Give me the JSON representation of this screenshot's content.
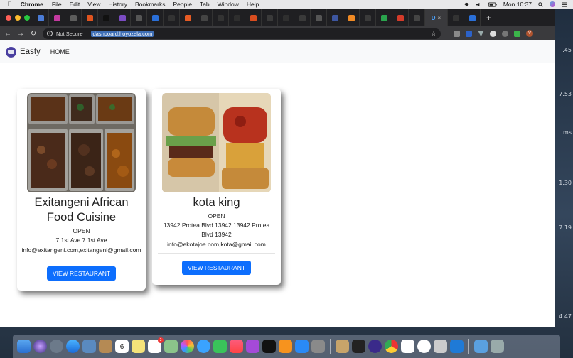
{
  "menubar": {
    "app_name": "Chrome",
    "items": [
      "File",
      "Edit",
      "View",
      "History",
      "Bookmarks",
      "People",
      "Tab",
      "Window",
      "Help"
    ],
    "clock": "Mon 10:37"
  },
  "browser": {
    "security_label": "Not Secure",
    "url": "dashboard.hoyozela.com",
    "active_tab_label": "D",
    "tab_favicon_colors": [
      "#4a7bd6",
      "#c43aa0",
      "#5c5c5c",
      "#e0541f",
      "#111",
      "#7a4bc2",
      "#555",
      "#2a6fd8",
      "#333",
      "#e65b24",
      "#444",
      "#333",
      "#2e2e2e",
      "#d94d1f",
      "#3a3a3a",
      "#2f2f2f",
      "#3a3a3a",
      "#555",
      "#3d56a0",
      "#f08a24",
      "#3a3a3a",
      "#2aa44d",
      "#d43b2a",
      "#444",
      "#333",
      "#2a6fd8"
    ],
    "avatar_letter": "V"
  },
  "navbar": {
    "brand": "Easty",
    "home_link": "HOME"
  },
  "restaurants": [
    {
      "name": "Exitangeni African Food Cuisine",
      "status": "OPEN",
      "address": "7 1st Ave 7 1st Ave",
      "email": "info@exitangeni.com,exitangeni@gmail.com",
      "button": "VIEW RESTAURANT"
    },
    {
      "name": "kota king",
      "status": "OPEN",
      "address": "13942 Protea Blvd 13942 13942 Protea Blvd 13942",
      "email": "info@ekotajoe.com,kota@gmail.com",
      "button": "VIEW RESTAURANT"
    }
  ],
  "desktop_numbers": [
    ".45",
    "7.53",
    "ms",
    "1.30",
    "7.19",
    "4.47"
  ],
  "dock": {
    "calendar_day": "6",
    "reminders_badge": "2"
  }
}
